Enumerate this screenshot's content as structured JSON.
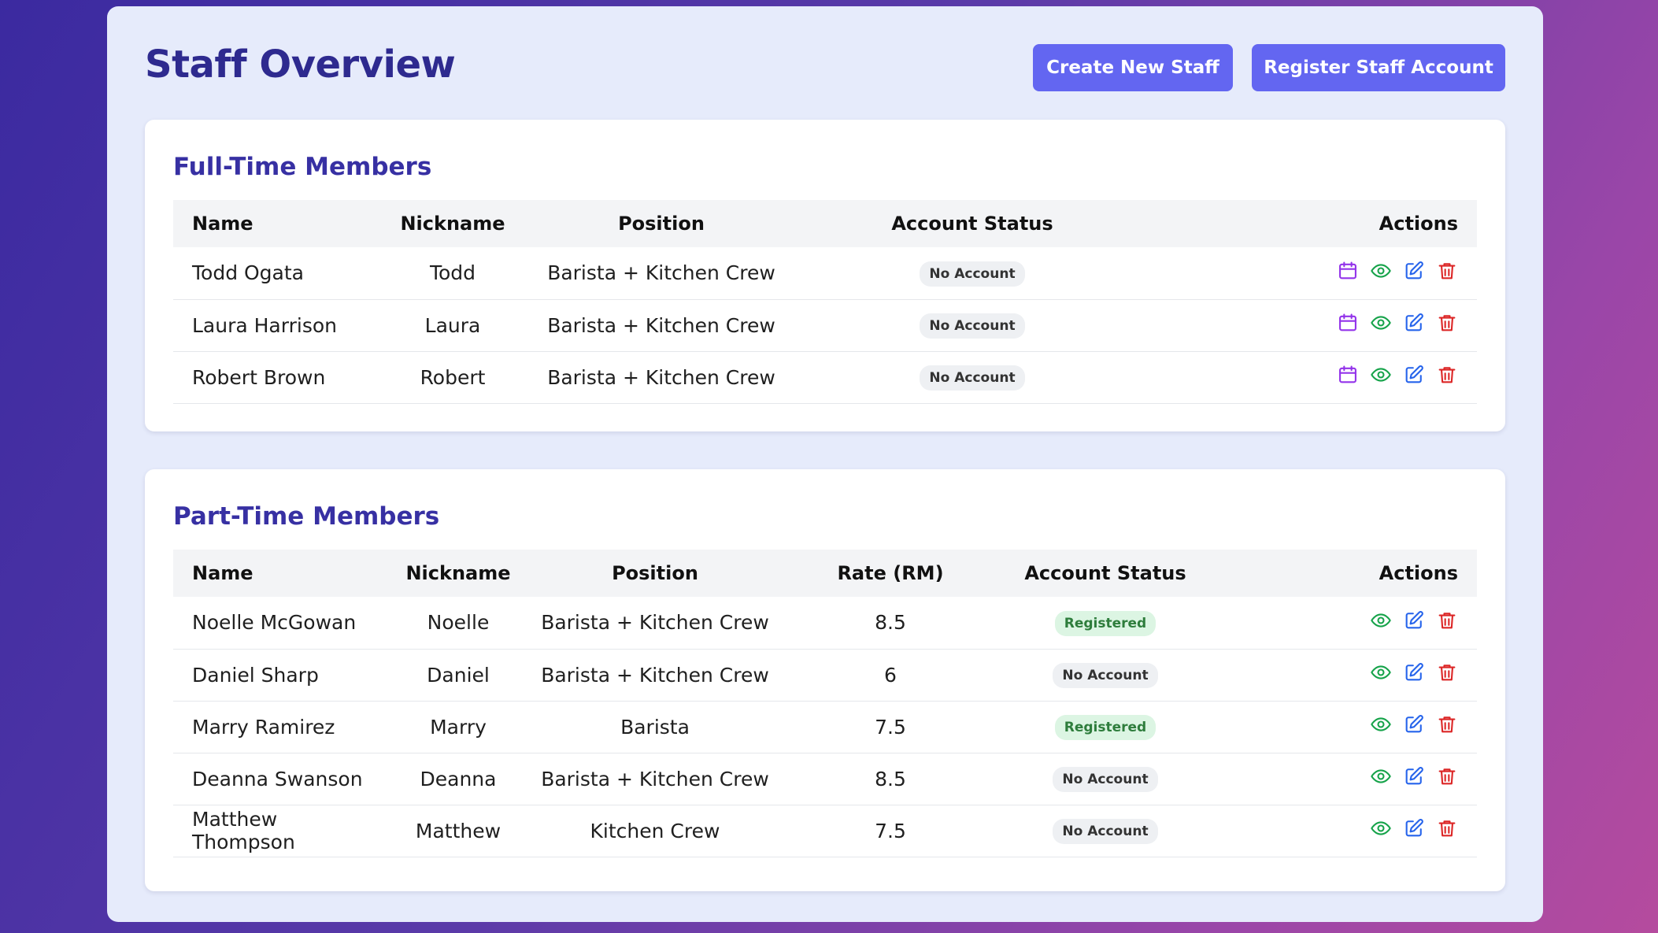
{
  "header": {
    "title": "Staff Overview",
    "create_label": "Create New Staff",
    "register_label": "Register Staff Account"
  },
  "full_time": {
    "title": "Full-Time Members",
    "columns": [
      "Name",
      "Nickname",
      "Position",
      "Account Status",
      "Actions"
    ],
    "rows": [
      {
        "name": "Todd Ogata",
        "nickname": "Todd",
        "position": "Barista + Kitchen Crew",
        "status": "No Account"
      },
      {
        "name": "Laura Harrison",
        "nickname": "Laura",
        "position": "Barista + Kitchen Crew",
        "status": "No Account"
      },
      {
        "name": "Robert Brown",
        "nickname": "Robert",
        "position": "Barista + Kitchen Crew",
        "status": "No Account"
      }
    ]
  },
  "part_time": {
    "title": "Part-Time Members",
    "columns": [
      "Name",
      "Nickname",
      "Position",
      "Rate (RM)",
      "Account Status",
      "Actions"
    ],
    "rows": [
      {
        "name": "Noelle McGowan",
        "nickname": "Noelle",
        "position": "Barista + Kitchen Crew",
        "rate": "8.5",
        "status": "Registered"
      },
      {
        "name": "Daniel Sharp",
        "nickname": "Daniel",
        "position": "Barista + Kitchen Crew",
        "rate": "6",
        "status": "No Account"
      },
      {
        "name": "Marry Ramirez",
        "nickname": "Marry",
        "position": "Barista",
        "rate": "7.5",
        "status": "Registered"
      },
      {
        "name": "Deanna Swanson",
        "nickname": "Deanna",
        "position": "Barista + Kitchen Crew",
        "rate": "8.5",
        "status": "No Account"
      },
      {
        "name": "Matthew Thompson",
        "nickname": "Matthew",
        "position": "Kitchen Crew",
        "rate": "7.5",
        "status": "No Account"
      }
    ]
  },
  "icons": {
    "schedule": "calendar-icon",
    "view": "eye-icon",
    "edit": "edit-icon",
    "delete": "trash-icon"
  },
  "colors": {
    "accent": "#6366f1",
    "title": "#2e2a8f",
    "calendar": "#9333ea",
    "view": "#16a34a",
    "edit": "#2563eb",
    "delete": "#dc2626",
    "registered_bg": "#dcf5e3",
    "no_account_bg": "#eef0f3"
  }
}
